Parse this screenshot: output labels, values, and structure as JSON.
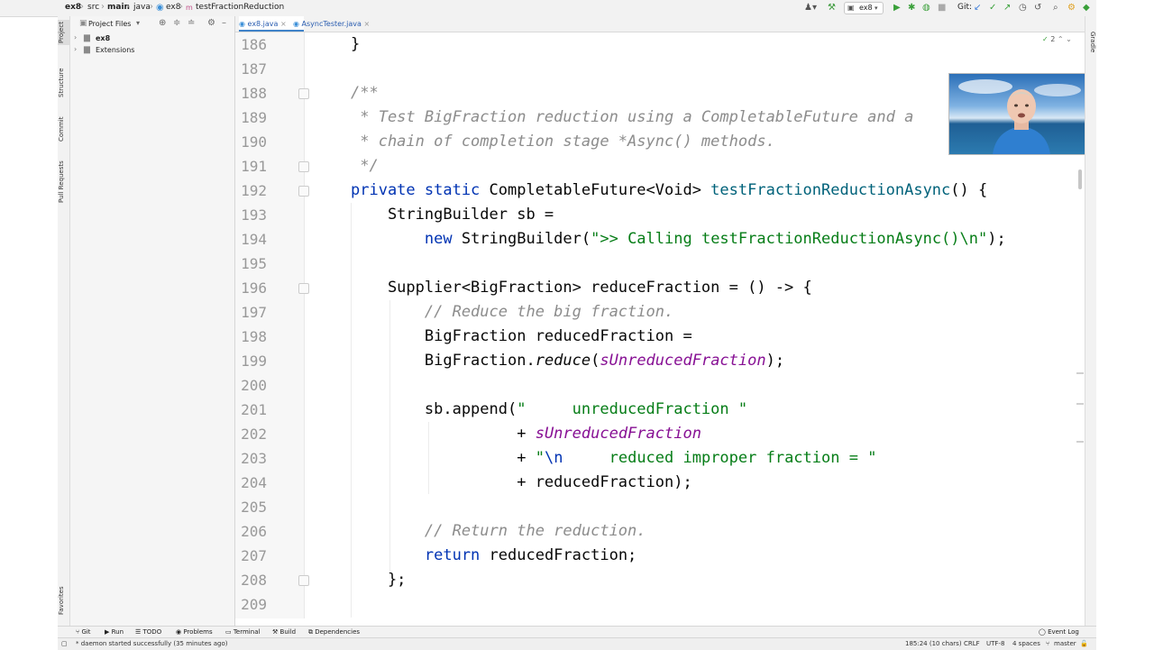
{
  "breadcrumbs": [
    "ex8",
    "src",
    "main",
    "java",
    "ex8",
    "testFractionReduction"
  ],
  "run_config": "ex8",
  "git_label": "Git:",
  "sidebar": {
    "title": "Project Files",
    "items": [
      "ex8",
      "Extensions"
    ]
  },
  "left_tabs": [
    "Project",
    "Structure",
    "Commit",
    "Pull Requests",
    "Favorites"
  ],
  "right_tabs": [
    "Gradle"
  ],
  "editor_tabs": [
    "ex8.java",
    "AsyncTester.java"
  ],
  "inspection_count": "2",
  "line_numbers": [
    "186",
    "187",
    "188",
    "189",
    "190",
    "191",
    "192",
    "193",
    "194",
    "195",
    "196",
    "197",
    "198",
    "199",
    "200",
    "201",
    "202",
    "203",
    "204",
    "205",
    "206",
    "207",
    "208",
    "209"
  ],
  "code": {
    "l186": "}",
    "l188": "/**",
    "l189": " * Test BigFraction reduction using a CompletableFuture and a",
    "l190": " * chain of completion stage *Async() methods.",
    "l191": " */",
    "l192_kw": "private static ",
    "l192_type": "CompletableFuture<Void> ",
    "l192_fn": "testFractionReductionAsync",
    "l192_end": "() {",
    "l193": "    StringBuilder sb =",
    "l194_kw": "        new ",
    "l194_a": "StringBuilder(",
    "l194_s1": "\">> Calling ",
    "l194_s2": "testFractionReductionAsync()",
    "l194_s3": "\\n\"",
    "l194_end": ");",
    "l196": "    Supplier<BigFraction> reduceFraction = () -> {",
    "l197": "        // Reduce the big fraction.",
    "l198": "        BigFraction reducedFraction =",
    "l199_a": "        BigFraction.",
    "l199_m": "reduce",
    "l199_b": "(",
    "l199_st": "sUnreducedFraction",
    "l199_end": ");",
    "l201_a": "        sb.append(",
    "l201_s": "\"     unreducedFraction \"",
    "l202_a": "                  + ",
    "l202_st": "sUnreducedFraction",
    "l203_a": "                  + ",
    "l203_s1": "\"",
    "l203_esc": "\\n",
    "l203_s2": "     reduced improper fraction = \"",
    "l204": "                  + reducedFraction);",
    "l206": "        // Return the reduction.",
    "l207_kw": "        return ",
    "l207_end": "reducedFraction;",
    "l208": "    };"
  },
  "bottom_tools": [
    "Git",
    "Run",
    "TODO",
    "Problems",
    "Terminal",
    "Build",
    "Dependencies",
    "Event Log"
  ],
  "status": {
    "message": "* daemon started successfully (35 minutes ago)",
    "position": "185:24 (10 chars)",
    "line_sep": "CRLF",
    "encoding": "UTF-8",
    "indent": "4 spaces",
    "branch": "master"
  },
  "colors": {
    "keyword": "#0033b3",
    "comment": "#8c8c8c",
    "string": "#067d17",
    "method": "#00627a",
    "static_field": "#871094"
  }
}
